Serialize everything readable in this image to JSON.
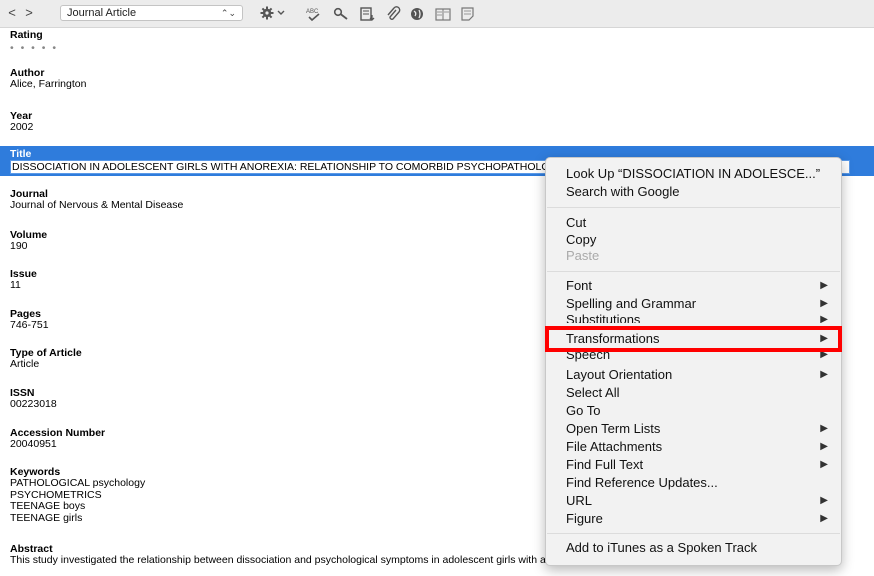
{
  "toolbar": {
    "back": "<",
    "forward": ">",
    "reference_type": "Journal Article",
    "reference_type_arrows": "⌃⌄",
    "icons": [
      "gear-menu-icon",
      "spelling-icon",
      "link-icon",
      "insert-citation-icon",
      "attachment-icon",
      "web-icon",
      "layout-icon",
      "note-icon"
    ]
  },
  "fields": {
    "rating_label": "Rating",
    "rating_value": "• • • • •",
    "author_label": "Author",
    "author_value": "Alice, Farrington",
    "year_label": "Year",
    "year_value": "2002",
    "title_label": "Title",
    "title_value": "DISSOCIATION IN ADOLESCENT GIRLS WITH ANOREXIA: RELATIONSHIP TO COMORBID PSYCHOPATHOLOGY",
    "journal_label": "Journal",
    "journal_value": "Journal of Nervous & Mental Disease",
    "volume_label": "Volume",
    "volume_value": "190",
    "issue_label": "Issue",
    "issue_value": "11",
    "pages_label": "Pages",
    "pages_value": "746-751",
    "type_label": "Type of Article",
    "type_value": "Article",
    "issn_label": "ISSN",
    "issn_value": "00223018",
    "accession_label": "Accession Number",
    "accession_value": "20040951",
    "keywords_label": "Keywords",
    "keywords": [
      "PATHOLOGICAL psychology",
      "PSYCHOMETRICS",
      "TEENAGE boys",
      "TEENAGE girls"
    ],
    "abstract_label": "Abstract",
    "abstract_value": "This study investigated the relationship between dissociation and psychological symptoms in adolescent girls with anorexia. First, the psychometric properties of the Adolescent"
  },
  "menu": {
    "lookup": "Look Up “DISSOCIATION IN ADOLESCE...”",
    "search_google": "Search with Google",
    "cut": "Cut",
    "copy": "Copy",
    "paste": "Paste",
    "font": "Font",
    "spelling": "Spelling and Grammar",
    "substitutions": "Substitutions",
    "transformations": "Transformations",
    "speech": "Speech",
    "layout_orientation": "Layout Orientation",
    "select_all": "Select All",
    "go_to": "Go To",
    "open_term_lists": "Open Term Lists",
    "file_attachments": "File Attachments",
    "find_full_text": "Find Full Text",
    "find_reference_updates": "Find Reference Updates...",
    "url": "URL",
    "figure": "Figure",
    "add_itunes": "Add to iTunes as a Spoken Track",
    "submenu_arrow": "▶"
  }
}
